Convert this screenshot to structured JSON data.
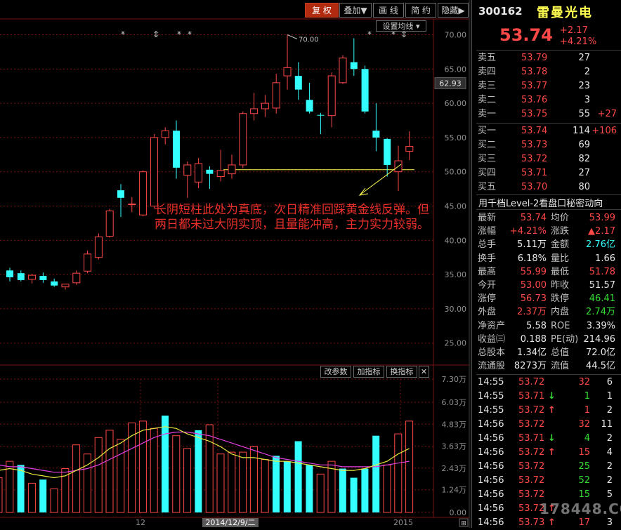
{
  "toolbar": {
    "buttons": [
      "复 权",
      "叠加▼",
      "画 线",
      "简 约",
      "隐藏▶"
    ],
    "settings": "设置均线 ▾"
  },
  "volume_toolbar": [
    "改参数",
    "加指标",
    "换指标",
    "✕"
  ],
  "annotation": "长阴短柱此处为真底，次日精准回踩黄金线反弹。但两日都未过大阴实顶，且量能冲高，主力实力较弱。",
  "watermark": "178448.COM",
  "stock": {
    "code": "300162",
    "name": "雷曼光电",
    "price": "53.74",
    "change": "+2.17",
    "change_pct": "+4.21%"
  },
  "orderbook": {
    "asks": [
      {
        "label": "卖五",
        "price": "53.79",
        "vol": "27",
        "delta": ""
      },
      {
        "label": "卖四",
        "price": "53.78",
        "vol": "2",
        "delta": ""
      },
      {
        "label": "卖三",
        "price": "53.77",
        "vol": "23",
        "delta": ""
      },
      {
        "label": "卖二",
        "price": "53.76",
        "vol": "3",
        "delta": ""
      },
      {
        "label": "卖一",
        "price": "53.75",
        "vol": "55",
        "delta": "+27"
      }
    ],
    "bids": [
      {
        "label": "买一",
        "price": "53.74",
        "vol": "114",
        "delta": "+106"
      },
      {
        "label": "买二",
        "price": "53.73",
        "vol": "69",
        "delta": ""
      },
      {
        "label": "买三",
        "price": "53.72",
        "vol": "82",
        "delta": ""
      },
      {
        "label": "买四",
        "price": "53.71",
        "vol": "27",
        "delta": ""
      },
      {
        "label": "买五",
        "price": "53.70",
        "vol": "80",
        "delta": ""
      }
    ]
  },
  "level2_banner": "用千档Level-2看盘口秘密动向",
  "stats": [
    {
      "l1": "最新",
      "v1": "53.74",
      "c1": "red",
      "l2": "均价",
      "v2": "53.99",
      "c2": "red"
    },
    {
      "l1": "涨幅",
      "v1": "+4.21%",
      "c1": "red",
      "l2": "涨跌",
      "v2": "▲2.17",
      "c2": "red"
    },
    {
      "l1": "总手",
      "v1": "5.11万",
      "c1": "wht",
      "l2": "金额",
      "v2": "2.76亿",
      "c2": "cyan"
    },
    {
      "l1": "换手",
      "v1": "6.18%",
      "c1": "wht",
      "l2": "量比",
      "v2": "1.66",
      "c2": "wht"
    },
    {
      "l1": "最高",
      "v1": "55.99",
      "c1": "red",
      "l2": "最低",
      "v2": "51.78",
      "c2": "red"
    },
    {
      "l1": "今开",
      "v1": "53.00",
      "c1": "red",
      "l2": "昨收",
      "v2": "51.57",
      "c2": "wht"
    },
    {
      "l1": "涨停",
      "v1": "56.73",
      "c1": "red",
      "l2": "跌停",
      "v2": "46.41",
      "c2": "grn"
    },
    {
      "l1": "外盘",
      "v1": "2.37万",
      "c1": "red",
      "l2": "内盘",
      "v2": "2.74万",
      "c2": "grn"
    },
    {
      "l1": "净资产",
      "v1": "5.58",
      "c1": "wht",
      "l2": "ROE",
      "v2": "3.39%",
      "c2": "wht"
    },
    {
      "l1": "收益㈢",
      "v1": "0.188",
      "c1": "wht",
      "l2": "PE(动)",
      "v2": "214.96",
      "c2": "wht"
    },
    {
      "l1": "总股本",
      "v1": "1.34亿",
      "c1": "wht",
      "l2": "总值",
      "v2": "72.0亿",
      "c2": "wht"
    },
    {
      "l1": "流通股",
      "v1": "8273万",
      "c1": "wht",
      "l2": "流值",
      "v2": "44.5亿",
      "c2": "wht"
    }
  ],
  "ticks": [
    {
      "time": "14:55",
      "price": "53.72",
      "arrow": "",
      "vol": "32",
      "cnt": "6",
      "vc": "red"
    },
    {
      "time": "14:55",
      "price": "53.71",
      "arrow": "↓",
      "vol": "1",
      "cnt": "1",
      "vc": "grn"
    },
    {
      "time": "14:55",
      "price": "53.72",
      "arrow": "↑",
      "vol": "1",
      "cnt": "2",
      "vc": "red"
    },
    {
      "time": "14:56",
      "price": "53.72",
      "arrow": "",
      "vol": "32",
      "cnt": "11",
      "vc": "red"
    },
    {
      "time": "14:56",
      "price": "53.71",
      "arrow": "↓",
      "vol": "4",
      "cnt": "2",
      "vc": "grn"
    },
    {
      "time": "14:56",
      "price": "53.72",
      "arrow": "↑",
      "vol": "15",
      "cnt": "4",
      "vc": "red"
    },
    {
      "time": "14:56",
      "price": "53.72",
      "arrow": "",
      "vol": "25",
      "cnt": "2",
      "vc": "grn"
    },
    {
      "time": "14:56",
      "price": "53.72",
      "arrow": "",
      "vol": "52",
      "cnt": "2",
      "vc": "grn"
    },
    {
      "time": "14:56",
      "price": "53.72",
      "arrow": "",
      "vol": "15",
      "cnt": "5",
      "vc": "grn"
    },
    {
      "time": "14:56",
      "price": "53.72",
      "arrow": "↑",
      "vol": "",
      "cnt": "",
      "vc": "red"
    },
    {
      "time": "14:56",
      "price": "53.73",
      "arrow": "↑",
      "vol": "17",
      "cnt": "3",
      "vc": "red"
    }
  ],
  "colors": {
    "up": "#ff4848",
    "down": "#33ffff",
    "ma_short": "#e8e840",
    "ma_long": "#e040e0",
    "grid": "#7a1010",
    "bg": "#000000"
  },
  "chart_data": [
    {
      "type": "candlestick",
      "ylim": [
        22,
        72
      ],
      "yticks": [
        "70.00",
        "65.00",
        "60.00",
        "55.00",
        "50.00",
        "45.00",
        "40.00",
        "35.00",
        "30.00",
        "25.00"
      ],
      "ytick_values": [
        70,
        65,
        60,
        55,
        50,
        45,
        40,
        35,
        30,
        25
      ],
      "current_price_label": "62.93",
      "current_price_value": 62.93,
      "high_label": "70.00",
      "support_line_value": 50.3,
      "ohlc": [
        [
          35.6,
          36.0,
          34.0,
          34.6
        ],
        [
          35.2,
          35.6,
          34.0,
          34.2
        ],
        [
          34.3,
          35.1,
          33.7,
          34.9
        ],
        [
          34.8,
          35.3,
          33.8,
          34.2
        ],
        [
          34.0,
          34.4,
          33.2,
          33.4
        ],
        [
          33.2,
          33.6,
          32.8,
          33.6
        ],
        [
          33.8,
          35.6,
          33.5,
          35.2
        ],
        [
          35.5,
          38.5,
          35.2,
          38.0
        ],
        [
          37.5,
          41.0,
          37.2,
          40.5
        ],
        [
          40.6,
          44.6,
          40.4,
          44.3
        ],
        [
          47.3,
          48.2,
          43.4,
          46.2
        ],
        [
          45.3,
          46.3,
          44.1,
          45.3
        ],
        [
          43.7,
          50.2,
          43.5,
          50.0
        ],
        [
          45.0,
          55.5,
          44.6,
          55.0
        ],
        [
          55.0,
          56.5,
          54.0,
          56.0
        ],
        [
          56.0,
          57.5,
          49.0,
          50.6
        ],
        [
          49.5,
          51.5,
          46.2,
          51.0
        ],
        [
          48.5,
          52.0,
          47.6,
          51.2
        ],
        [
          50.3,
          50.8,
          47.5,
          49.7
        ],
        [
          49.3,
          53.2,
          48.6,
          50.2
        ],
        [
          49.7,
          52.5,
          49.0,
          51.0
        ],
        [
          51.0,
          58.8,
          50.5,
          58.5
        ],
        [
          58.5,
          61.5,
          57.5,
          59.2
        ],
        [
          59.2,
          61.2,
          58.0,
          60.0
        ],
        [
          59.3,
          64.3,
          58.5,
          63.0
        ],
        [
          64.0,
          70.0,
          62.0,
          65.2
        ],
        [
          64.0,
          66.0,
          60.5,
          62.0
        ],
        [
          60.5,
          63.0,
          58.5,
          58.8
        ],
        [
          58.3,
          58.6,
          55.5,
          58.2
        ],
        [
          58.2,
          64.5,
          56.5,
          64.0
        ],
        [
          63.0,
          67.0,
          62.8,
          66.6
        ],
        [
          66.0,
          69.5,
          64.0,
          65.0
        ],
        [
          65.0,
          65.5,
          58.5,
          58.8
        ],
        [
          56.0,
          60.0,
          53.0,
          55.0
        ],
        [
          54.8,
          54.9,
          49.3,
          51.0
        ],
        [
          50.0,
          53.8,
          47.2,
          51.6
        ],
        [
          53.0,
          55.9,
          51.7,
          53.7
        ]
      ]
    },
    {
      "type": "bar",
      "title": "volume",
      "ylim": [
        0,
        7.3
      ],
      "yticks": [
        "7.30万",
        "6.03万",
        "4.83万",
        "3.63万",
        "2.43万",
        "1.24万",
        "0.00"
      ],
      "ytick_values": [
        7.3,
        6.03,
        4.83,
        3.63,
        2.43,
        1.24,
        0
      ],
      "xticks": [
        "12",
        "2014/12/9/二",
        "2015"
      ],
      "values": [
        1.9,
        2.8,
        2.6,
        1.6,
        1.8,
        1.3,
        2.4,
        3.7,
        3.2,
        4.1,
        4.5,
        4.0,
        4.9,
        5.0,
        4.6,
        5.3,
        4.2,
        3.5,
        4.5,
        4.8,
        3.2,
        3.3,
        3.3,
        3.6,
        2.9,
        3.1,
        2.8,
        3.9,
        2.6,
        2.1,
        2.8,
        2.4,
        1.9,
        2.4,
        4.2,
        2.6,
        4.3,
        5.0
      ],
      "up": [
        true,
        true,
        false,
        true,
        false,
        true,
        true,
        true,
        true,
        true,
        true,
        true,
        true,
        true,
        true,
        false,
        true,
        true,
        false,
        true,
        true,
        true,
        true,
        true,
        true,
        false,
        false,
        false,
        false,
        true,
        true,
        false,
        false,
        false,
        false,
        true,
        true,
        true
      ],
      "ma_short": [
        2.3,
        2.4,
        2.3,
        2.1,
        2.0,
        1.9,
        2.0,
        2.3,
        2.6,
        3.0,
        3.5,
        3.8,
        4.2,
        4.5,
        4.6,
        4.7,
        4.6,
        4.3,
        4.1,
        3.9,
        3.6,
        3.2,
        3.0,
        3.0,
        2.9,
        2.8,
        2.8,
        2.7,
        2.6,
        2.5,
        2.4,
        2.3,
        2.3,
        2.4,
        2.6,
        2.8,
        3.2,
        3.5
      ],
      "ma_long": [
        2.6,
        2.5,
        2.5,
        2.4,
        2.3,
        2.2,
        2.2,
        2.3,
        2.4,
        2.6,
        2.9,
        3.2,
        3.5,
        3.8,
        4.1,
        4.3,
        4.4,
        4.4,
        4.3,
        4.2,
        4.0,
        3.8,
        3.6,
        3.4,
        3.2,
        3.0,
        2.9,
        2.8,
        2.7,
        2.6,
        2.6,
        2.5,
        2.5,
        2.5,
        2.5,
        2.6,
        2.7,
        2.8
      ]
    }
  ]
}
